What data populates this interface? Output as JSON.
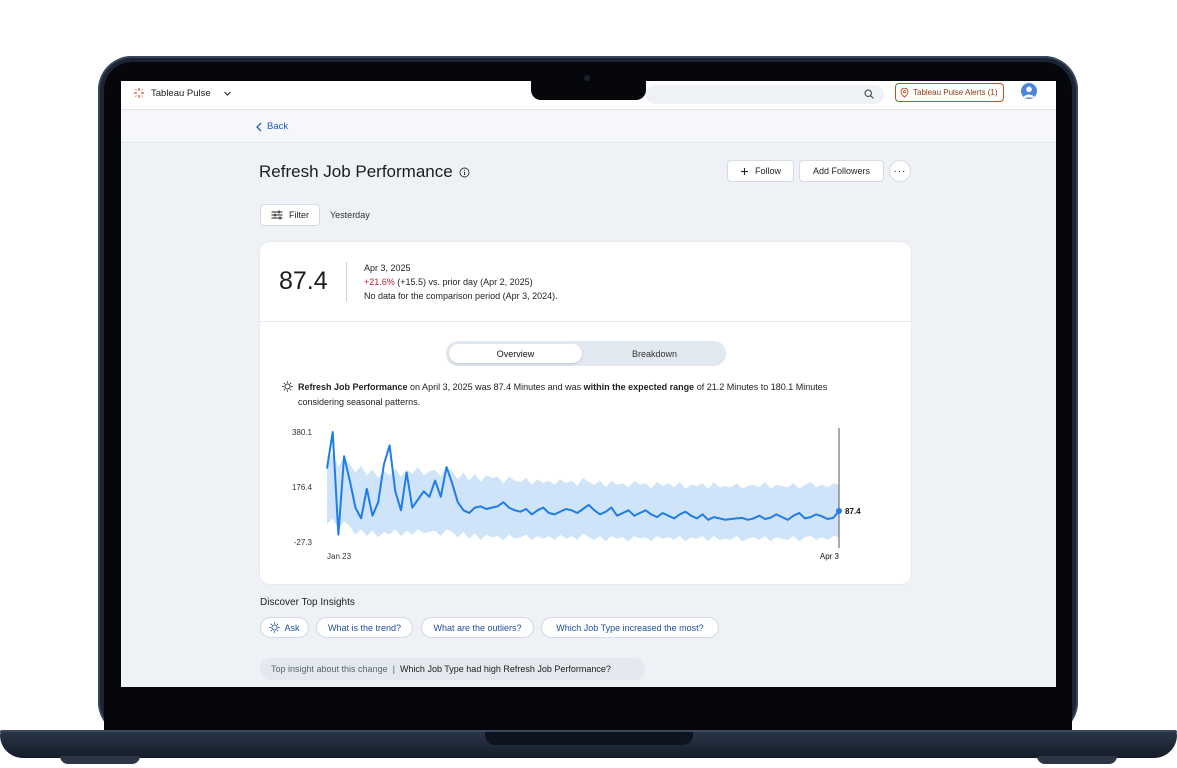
{
  "app": {
    "name": "Tableau Pulse",
    "alerts_label": "Tableau Pulse Alerts (1)"
  },
  "nav": {
    "back_label": "Back"
  },
  "header": {
    "title": "Refresh Job Performance",
    "follow_label": "Follow",
    "add_followers_label": "Add Followers",
    "more_label": "···"
  },
  "filters": {
    "filter_label": "Filter",
    "range_label": "Yesterday"
  },
  "metric": {
    "value": "87.4",
    "date": "Apr 3, 2025",
    "change_pct": "+21.6%",
    "change_detail": " (+15.5) vs. prior day (Apr 2, 2025)",
    "comparison_note": "No data for the comparison period (Apr 3, 2024)."
  },
  "tabs": [
    {
      "label": "Overview",
      "selected": true
    },
    {
      "label": "Breakdown",
      "selected": false
    }
  ],
  "insight": {
    "metric_name": "Refresh Job Performance",
    "text_1": " on April 3, 2025 was 87.4 Minutes and was ",
    "emphasis": "within the expected range",
    "text_2": " of 21.2 Minutes to 180.1 Minutes considering seasonal patterns."
  },
  "chart_data": {
    "type": "line",
    "x_labels": [
      "Jan 23",
      "Apr 3"
    ],
    "y_ticks": [
      "380.1",
      "176.4",
      "-27.3"
    ],
    "ylim": [
      -27.3,
      380.1
    ],
    "end_label": "87.4",
    "line_color": "#1f7de8",
    "band_color": "#cfe4f8",
    "series": [
      {
        "values": [
          245,
          380,
          0,
          290,
          200,
          100,
          60,
          170,
          70,
          120,
          260,
          330,
          160,
          90,
          230,
          100,
          130,
          160,
          140,
          200,
          140,
          250,
          190,
          120,
          90,
          80,
          100,
          105,
          95,
          100,
          105,
          120,
          100,
          90,
          85,
          95,
          75,
          90,
          100,
          80,
          75,
          85,
          95,
          90,
          80,
          95,
          110,
          90,
          75,
          85,
          100,
          70,
          80,
          90,
          70,
          80,
          90,
          75,
          65,
          80,
          70,
          60,
          75,
          85,
          70,
          60,
          75,
          55,
          65,
          60,
          55,
          58,
          60,
          62,
          55,
          60,
          70,
          58,
          63,
          75,
          65,
          55,
          70,
          80,
          60,
          65,
          75,
          68,
          58,
          62,
          87.4
        ]
      }
    ],
    "expected_range": {
      "upper": [
        270,
        300,
        250,
        290,
        260,
        230,
        255,
        220,
        240,
        210,
        235,
        220,
        245,
        215,
        240,
        225,
        250,
        220,
        235,
        240,
        215,
        250,
        235,
        205,
        230,
        200,
        225,
        195,
        220,
        210,
        215,
        190,
        215,
        200,
        195,
        210,
        185,
        205,
        190,
        200,
        185,
        205,
        190,
        200,
        180,
        210,
        195,
        185,
        200,
        175,
        200,
        185,
        190,
        175,
        200,
        185,
        190,
        170,
        195,
        180,
        190,
        175,
        195,
        170,
        185,
        180,
        190,
        170,
        195,
        175,
        180,
        175,
        190,
        170,
        180,
        185,
        175,
        195,
        170,
        185,
        180,
        175,
        190,
        170,
        185,
        195,
        175,
        185,
        175,
        190,
        185
      ],
      "lower": [
        40,
        60,
        20,
        50,
        30,
        0,
        20,
        -5,
        15,
        -10,
        10,
        0,
        20,
        -5,
        15,
        0,
        20,
        5,
        10,
        15,
        -5,
        20,
        10,
        -10,
        10,
        -15,
        5,
        -20,
        0,
        -10,
        -5,
        -20,
        0,
        -15,
        -10,
        0,
        -20,
        -5,
        -15,
        -5,
        -20,
        0,
        -15,
        -5,
        -20,
        5,
        -10,
        -20,
        -5,
        -25,
        -5,
        -15,
        -10,
        -25,
        -5,
        -15,
        -10,
        -25,
        -5,
        -15,
        -10,
        -20,
        -5,
        -25,
        -10,
        -15,
        -5,
        -25,
        -5,
        -20,
        -15,
        -20,
        -5,
        -25,
        -15,
        -10,
        -20,
        -5,
        -25,
        -10,
        -15,
        -20,
        -5,
        -25,
        -10,
        -5,
        -20,
        -10,
        -20,
        -5,
        -10
      ]
    }
  },
  "discover": {
    "heading": "Discover Top Insights",
    "ask_label": "Ask",
    "questions": [
      "What is the trend?",
      "What are the outliers?",
      "Which Job Type increased the most?"
    ]
  },
  "top_insight": {
    "prefix": "Top insight about this change",
    "separator": "|",
    "question": "Which Job Type had high Refresh Job Performance?"
  }
}
